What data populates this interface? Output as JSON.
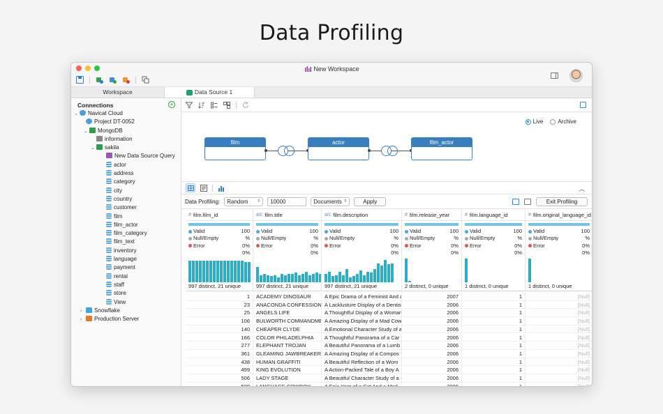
{
  "hero_title": "Data Profiling",
  "window": {
    "title": "New Workspace"
  },
  "tabs": [
    {
      "label": "Workspace"
    },
    {
      "label": "Data Source 1"
    }
  ],
  "sidebar": {
    "heading": "Connections",
    "tree": [
      {
        "label": "Navicat Cloud",
        "indent": 0,
        "chev": "v",
        "icon": "cloud-icon"
      },
      {
        "label": "Project DT-0052",
        "indent": 1,
        "chev": "",
        "icon": "project-icon"
      },
      {
        "label": "MongoDB",
        "indent": 2,
        "chev": "v",
        "icon": "mongodb-icon"
      },
      {
        "label": "information",
        "indent": 3,
        "chev": "",
        "icon": "info-icon"
      },
      {
        "label": "sakila",
        "indent": 3,
        "chev": "v",
        "icon": "database-icon"
      },
      {
        "label": "New Data Source Query",
        "indent": 4,
        "chev": "",
        "icon": "query-icon"
      },
      {
        "label": "actor",
        "indent": 4,
        "chev": "",
        "icon": "collection-icon"
      },
      {
        "label": "address",
        "indent": 4,
        "chev": "",
        "icon": "collection-icon"
      },
      {
        "label": "category",
        "indent": 4,
        "chev": "",
        "icon": "collection-icon"
      },
      {
        "label": "city",
        "indent": 4,
        "chev": "",
        "icon": "collection-icon"
      },
      {
        "label": "country",
        "indent": 4,
        "chev": "",
        "icon": "collection-icon"
      },
      {
        "label": "customer",
        "indent": 4,
        "chev": "",
        "icon": "collection-icon"
      },
      {
        "label": "film",
        "indent": 4,
        "chev": "",
        "icon": "collection-icon"
      },
      {
        "label": "film_actor",
        "indent": 4,
        "chev": "",
        "icon": "collection-icon"
      },
      {
        "label": "film_category",
        "indent": 4,
        "chev": "",
        "icon": "collection-icon"
      },
      {
        "label": "film_text",
        "indent": 4,
        "chev": "",
        "icon": "collection-icon"
      },
      {
        "label": "inventory",
        "indent": 4,
        "chev": "",
        "icon": "collection-icon"
      },
      {
        "label": "language",
        "indent": 4,
        "chev": "",
        "icon": "collection-icon"
      },
      {
        "label": "payment",
        "indent": 4,
        "chev": "",
        "icon": "collection-icon"
      },
      {
        "label": "rental",
        "indent": 4,
        "chev": "",
        "icon": "collection-icon"
      },
      {
        "label": "staff",
        "indent": 4,
        "chev": "",
        "icon": "collection-icon"
      },
      {
        "label": "store",
        "indent": 4,
        "chev": "",
        "icon": "collection-icon"
      },
      {
        "label": "View",
        "indent": 4,
        "chev": "",
        "icon": "collection-icon"
      },
      {
        "label": "Snowflake",
        "indent": 1,
        "chev": ">",
        "icon": "snowflake-icon"
      },
      {
        "label": "Production Server",
        "indent": 1,
        "chev": ">",
        "icon": "server-icon"
      }
    ]
  },
  "diagram": {
    "mode_live": "Live",
    "mode_archive": "Archive",
    "nodes": [
      "film",
      "actor",
      "film_actor"
    ]
  },
  "profiling": {
    "label": "Data Profiling:",
    "sampling": "Random",
    "limit": "10000",
    "target": "Documents",
    "apply": "Apply",
    "exit": "Exit Profiling"
  },
  "columns": [
    {
      "type": "#",
      "name": "film.film_id",
      "valid": "100",
      "null": "%",
      "error": "0%",
      "extra": "0%",
      "distinct": "997 distinct, 21 unique",
      "hist": [
        0.9,
        0.9,
        0.9,
        0.9,
        0.9,
        0.9,
        0.9,
        0.9,
        0.9,
        0.9,
        0.9,
        0.9,
        0.9,
        0.9,
        0.9,
        0.9,
        0.85,
        0.85
      ]
    },
    {
      "type": "a/c",
      "name": "film.title",
      "valid": "100",
      "null": "%",
      "error": "0%",
      "extra": "0%",
      "distinct": "997 distinct, 21 unique",
      "hist": [
        0.65,
        0.3,
        0.35,
        0.3,
        0.25,
        0.3,
        0.2,
        0.35,
        0.3,
        0.35,
        0.35,
        0.4,
        0.3,
        0.35,
        0.45,
        0.3,
        0.35,
        0.4,
        0.35,
        0.4
      ]
    },
    {
      "type": "a/c",
      "name": "film.description",
      "valid": "100",
      "null": "%",
      "error": "0%",
      "extra": "0%",
      "distinct": "997 distinct, 21 unique",
      "hist": [
        0.35,
        0.45,
        0.25,
        0.3,
        0.45,
        0.3,
        0.55,
        0.2,
        0.25,
        0.35,
        0.5,
        0.3,
        0.45,
        0.4,
        0.55,
        0.8,
        0.7,
        0.95,
        0.75,
        0.8
      ]
    },
    {
      "type": "#",
      "name": "film.release_year",
      "valid": "100",
      "null": "%",
      "error": "0%",
      "extra": "0%",
      "distinct": "2 distinct, 0 unique",
      "hist": [
        1.0,
        0.06
      ]
    },
    {
      "type": "#",
      "name": "film.language_id",
      "valid": "100",
      "null": "%",
      "error": "0%",
      "extra": "0%",
      "distinct": "1 distinct, 0 unique",
      "hist": [
        1.0
      ]
    },
    {
      "type": "#",
      "name": "film.original_language_id",
      "valid": "100",
      "null": "%",
      "error": "0%",
      "extra": "0%",
      "distinct": "1 distinct, 0 unique",
      "hist": [
        1.0
      ]
    }
  ],
  "stat_labels": {
    "valid": "Valid",
    "null": "Null/Empty",
    "error": "Error"
  },
  "rows": [
    [
      "1",
      "ACADEMY DINOSAUR",
      "A Epic Drama of a Feminist And a",
      "2007",
      "1",
      "[Null]"
    ],
    [
      "23",
      "ANACONDA CONFESSIONS",
      "A Lacklusture Display of a Dentist",
      "2006",
      "1",
      "[Null]"
    ],
    [
      "25",
      "ANGELS LIFE",
      "A Thoughtful Display of a Woman",
      "2006",
      "1",
      "[Null]"
    ],
    [
      "106",
      "BULWORTH COMMANDME",
      "A Amazing Display of a Mad Cow",
      "2006",
      "1",
      "[Null]"
    ],
    [
      "140",
      "CHEAPER CLYDE",
      "A Emotional Character Study of a",
      "2006",
      "1",
      "[Null]"
    ],
    [
      "166",
      "COLOR PHILADELPHIA",
      "A Thoughtful Panorama of a Car",
      "2006",
      "1",
      "[Null]"
    ],
    [
      "277",
      "ELEPHANT TROJAN",
      "A Beautiful Panorama of a Lumb",
      "2006",
      "1",
      "[Null]"
    ],
    [
      "361",
      "GLEAMING JAWBREAKER",
      "A Amazing Display of a Compos",
      "2006",
      "1",
      "[Null]"
    ],
    [
      "438",
      "HUMAN GRAFFITI",
      "A Beautiful Reflection of a Wom",
      "2006",
      "1",
      "[Null]"
    ],
    [
      "499",
      "KING EVOLUTION",
      "A Action-Packed Tale of a Boy A",
      "2006",
      "1",
      "[Null]"
    ],
    [
      "506",
      "LADY STAGE",
      "A Beautiful Character Study of a",
      "2006",
      "1",
      "[Null]"
    ],
    [
      "509",
      "LANGUAGE COWBOY",
      "A Epic Yarn of a Cat And a Mad",
      "2006",
      "1",
      "[Null]"
    ]
  ]
}
